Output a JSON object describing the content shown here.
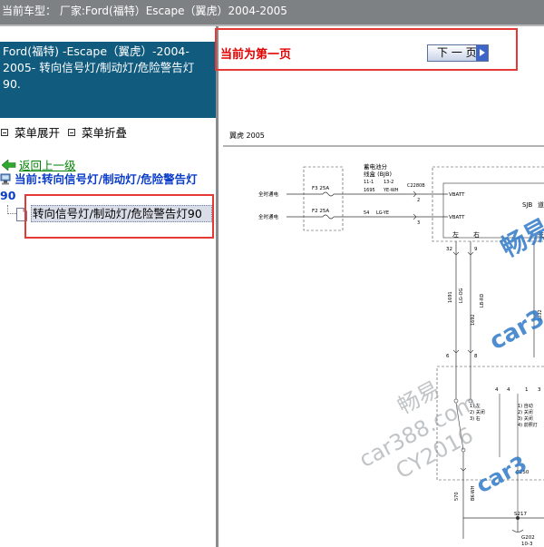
{
  "topbar": {
    "title": "当前车型： 厂家:Ford(福特）Escape（翼虎）2004-2005"
  },
  "left": {
    "header": "Ford(福特) -Escape（翼虎）-2004-2005- 转向信号灯/制动灯/危险警告灯 90.",
    "expand_all": "菜单展开",
    "collapse_all": "菜单折叠",
    "back": "返回上一级",
    "current": "当前:转向信号灯/制动灯/危险警告灯 90",
    "tree_item": "转向信号灯/制动灯/危险警告灯90"
  },
  "right": {
    "page_message": "当前为第一页",
    "next_button": "下 一 页",
    "diagram": {
      "caption": "翼虎 2005",
      "jb_label_1": "蓄电池分",
      "jb_label_2": "线盒 (BJB)",
      "fuse1": "F3 25A",
      "fuse2": "F2 25A",
      "always_hot_1": "全时通电",
      "always_hot_2": "全时通电",
      "pin_11_1": "11-1",
      "pin_13_2": "13-2",
      "wire_1695": "1695",
      "wire_yewh": "YE-WH",
      "wire_54": "54",
      "wire_lgye": "LG-YE",
      "conn_c2280b": "C2280B",
      "pin_2": "2",
      "pin_3": "3",
      "vbatt1": "VBATT",
      "vbatt2": "VBATT",
      "sjb": "SJB",
      "sjb_tail": "道",
      "left": "左",
      "right": "右",
      "right_tail": "驻",
      "p32": "32",
      "p9": "9",
      "p1691": "1691",
      "plgog": "LG-OG",
      "p1692": "1692",
      "plbrd": "LB-RD",
      "p1032": "1032",
      "p6": "6",
      "p8": "8",
      "p4": "4",
      "p1": "1",
      "p3": "3",
      "sw1_1": "1) 左",
      "sw1_2": "2) 关闭",
      "sw1_3": "3) 右",
      "sw2_1": "1) 自动",
      "sw2_2": "2) 关闭",
      "sw2_3": "3) 关闭",
      "sw2_4": "4) 前照灯",
      "c250": "C250",
      "p570": "570",
      "pbkwh": "BK-WH",
      "s217": "S217",
      "g202": "G202",
      "g202_sub": "10-3",
      "wm_1": "畅易",
      "wm_2": "car388.com",
      "wm_3": "CY2016",
      "wm_4": "畅易",
      "wm_5": "car3",
      "wm_6": "car3"
    }
  },
  "colors": {
    "topbar_bg": "#7e8183",
    "header_bg": "#115b7f",
    "current_text": "#0a3cc8",
    "back_link": "#008000",
    "page_message": "#e00000",
    "highlight_box": "#e53935",
    "watermark_blue": "#2f79c7"
  }
}
